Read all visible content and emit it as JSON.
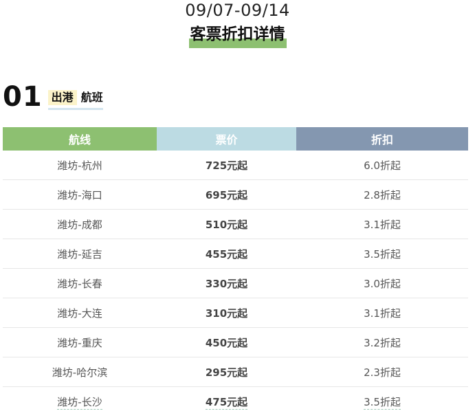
{
  "header": {
    "date_range": "09/07-09/14",
    "title": "客票折扣详情"
  },
  "section": {
    "number": "01",
    "highlight": "出港",
    "label": "航班"
  },
  "table": {
    "columns": [
      "航线",
      "票价",
      "折扣"
    ],
    "rows": [
      {
        "route": "潍坊-杭州",
        "price": "725元起",
        "discount": "6.0折起"
      },
      {
        "route": "潍坊-海口",
        "price": "695元起",
        "discount": "2.8折起"
      },
      {
        "route": "潍坊-成都",
        "price": "510元起",
        "discount": "3.1折起"
      },
      {
        "route": "潍坊-延吉",
        "price": "455元起",
        "discount": "3.5折起"
      },
      {
        "route": "潍坊-长春",
        "price": "330元起",
        "discount": "3.0折起"
      },
      {
        "route": "潍坊-大连",
        "price": "310元起",
        "discount": "3.1折起"
      },
      {
        "route": "潍坊-重庆",
        "price": "450元起",
        "discount": "3.2折起"
      },
      {
        "route": "潍坊-哈尔滨",
        "price": "295元起",
        "discount": "2.3折起"
      },
      {
        "route": "潍坊-长沙",
        "price": "475元起",
        "discount": "3.5折起"
      }
    ]
  },
  "colors": {
    "route_header": "#8dc071",
    "price_header": "#bcdbe3",
    "discount_header": "#8497b0",
    "title_underline": "#8dc071",
    "label_highlight": "#fbf3c9"
  }
}
